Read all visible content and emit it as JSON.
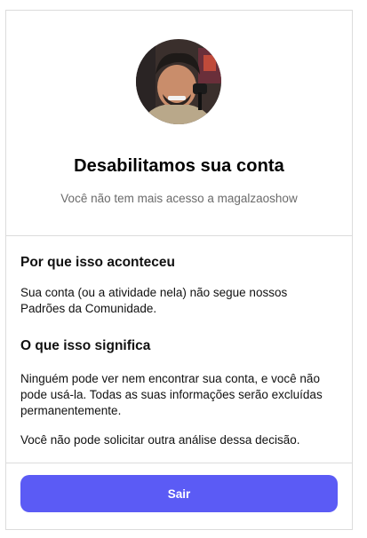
{
  "header": {
    "title": "Desabilitamos sua conta",
    "subtitle": "Você não tem mais acesso a magalzaoshow",
    "avatar_icon": "profile-photo"
  },
  "sections": [
    {
      "heading": "Por que isso aconteceu",
      "paragraphs": [
        "Sua conta (ou a atividade nela) não segue nossos Padrões da Comunidade."
      ]
    },
    {
      "heading": "O que isso significa",
      "paragraphs": [
        "Ninguém pode ver nem encontrar sua conta, e você não pode usá-la. Todas as suas informações serão excluídas permanentemente.",
        "Você não pode solicitar outra análise dessa decisão."
      ]
    }
  ],
  "footer": {
    "exit_label": "Sair"
  },
  "colors": {
    "button": "#5b5bf5",
    "border": "#dcdcdc",
    "subtitle": "#6b6b6b"
  }
}
